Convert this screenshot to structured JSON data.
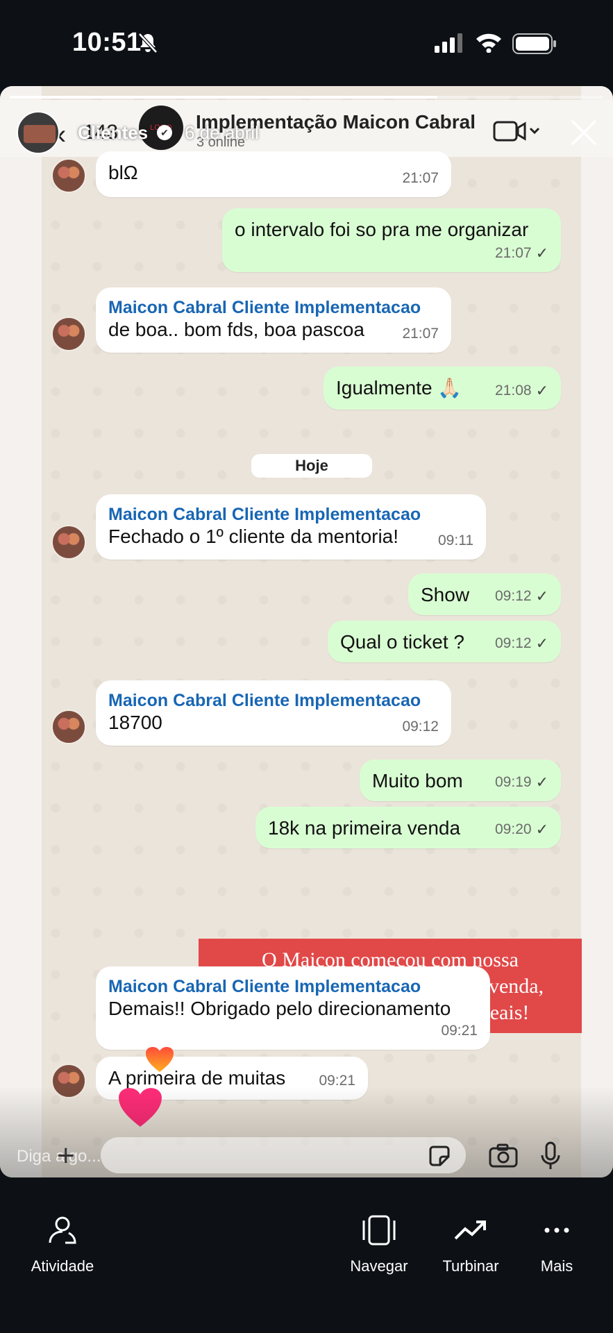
{
  "status_bar": {
    "time": "10:51"
  },
  "story": {
    "progress": 0.72,
    "user": "Clientes",
    "date": "6 de abril"
  },
  "chat_header": {
    "back_count": "143",
    "title": "Implementação Maicon Cabral",
    "subtitle": "3 online"
  },
  "messages": [
    {
      "dir": "in",
      "sender": "",
      "text": "blΩ",
      "time": "21:07"
    },
    {
      "dir": "out",
      "text": "o intervalo foi so pra me organizar",
      "time": "21:07"
    },
    {
      "dir": "in",
      "sender": "Maicon Cabral Cliente Implementacao",
      "text": "de boa.. bom fds, boa pascoa",
      "time": "21:07"
    },
    {
      "dir": "out",
      "text": "Igualmente 🙏🏻",
      "time": "21:08"
    },
    {
      "dir": "in",
      "sender": "Maicon Cabral Cliente Implementacao",
      "text": "Fechado o 1º cliente da mentoria!",
      "time": "09:11"
    },
    {
      "dir": "out",
      "text": "Show",
      "time": "09:12"
    },
    {
      "dir": "out",
      "text": "Qual o ticket ?",
      "time": "09:12"
    },
    {
      "dir": "in",
      "sender": "Maicon Cabral Cliente Implementacao",
      "text": "18700",
      "time": "09:12"
    },
    {
      "dir": "out",
      "text": "Muito bom",
      "time": "09:19"
    },
    {
      "dir": "out",
      "text": "18k na primeira venda",
      "time": "09:20"
    },
    {
      "dir": "in",
      "sender": "Maicon Cabral Cliente Implementacao",
      "text": "Demais!! Obrigado pelo direcionamento",
      "time": "09:21"
    },
    {
      "dir": "in",
      "sender": "",
      "text": "A primeira de muitas",
      "time": "09:21"
    }
  ],
  "date_chip": "Hoje",
  "overlay": "O Maicon começou com nossa implementação e já em sua 1ª venda, conseguiu passar do 18 mil reais!",
  "composer": {
    "placeholder": "Diga algo..."
  },
  "bottom_tabs": [
    {
      "label": "Atividade",
      "icon": "activity-icon"
    },
    {
      "label": "Navegar",
      "icon": "browse-icon"
    },
    {
      "label": "Turbinar",
      "icon": "trending-icon"
    },
    {
      "label": "Mais",
      "icon": "more-icon"
    }
  ]
}
